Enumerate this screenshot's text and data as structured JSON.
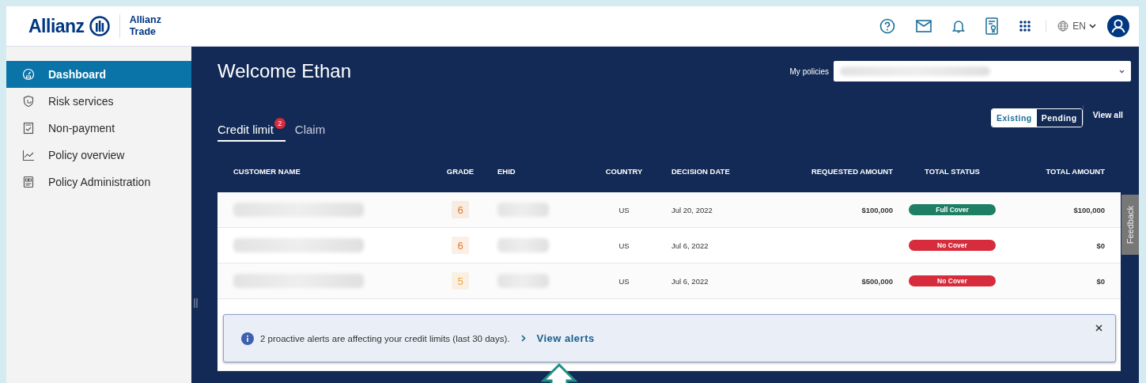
{
  "header": {
    "logo": "Allianz",
    "product_lines": [
      "Allianz",
      "Trade"
    ],
    "language": "EN"
  },
  "sidebar": {
    "items": [
      {
        "label": "Dashboard",
        "selected": true
      },
      {
        "label": "Risk services",
        "selected": false
      },
      {
        "label": "Non-payment",
        "selected": false
      },
      {
        "label": "Policy overview",
        "selected": false
      },
      {
        "label": "Policy Administration",
        "selected": false
      }
    ]
  },
  "main": {
    "welcome": "Welcome Ethan",
    "policies_label": "My policies",
    "tabs": [
      {
        "label": "Credit limit",
        "badge": "2",
        "selected": true
      },
      {
        "label": "Claim",
        "selected": false
      }
    ],
    "segments": [
      {
        "label": "Existing",
        "selected": false
      },
      {
        "label": "Pending",
        "selected": true
      }
    ],
    "view_all": "View all",
    "table": {
      "columns": [
        "CUSTOMER NAME",
        "GRADE",
        "EHID",
        "COUNTRY",
        "DECISION DATE",
        "REQUESTED AMOUNT",
        "TOTAL STATUS",
        "TOTAL AMOUNT"
      ],
      "rows": [
        {
          "grade": {
            "label": "6",
            "color": "#e07a2e"
          },
          "country": "US",
          "decision_date": "Jul 20, 2022",
          "requested_amount": "$100,000",
          "status": {
            "label": "Full Cover",
            "color": "#1e7f64"
          },
          "total_amount": "$100,000"
        },
        {
          "grade": {
            "label": "6",
            "color": "#e07a2e"
          },
          "country": "US",
          "decision_date": "Jul 6, 2022",
          "status": {
            "label": "No Cover",
            "color": "#d62c3c"
          },
          "total_amount": "$0"
        },
        {
          "grade": {
            "label": "5",
            "color": "#eda43a"
          },
          "country": "US",
          "decision_date": "Jul 6, 2022",
          "requested_amount": "$500,000",
          "status": {
            "label": "No Cover",
            "color": "#d62c3c"
          },
          "total_amount": "$0"
        }
      ]
    },
    "alert": {
      "text": "2 proactive alerts are affecting your credit limits (last 30 days).",
      "link": "View alerts"
    },
    "feedback": "Feedback"
  }
}
